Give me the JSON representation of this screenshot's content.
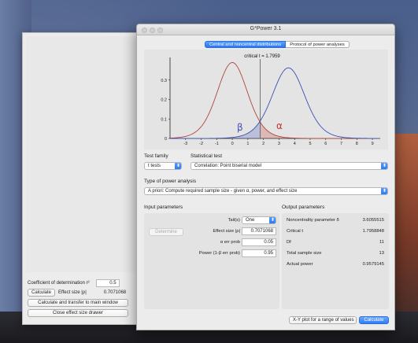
{
  "window": {
    "title": "G*Power 3.1"
  },
  "tabs": [
    {
      "label": "Central and noncentral distributions",
      "active": true
    },
    {
      "label": "Protocol of power analyses",
      "active": false
    }
  ],
  "plot": {
    "critical_label": "critical t = 1.7959",
    "beta_symbol": "β",
    "alpha_symbol": "α",
    "y_ticks": [
      "0.3",
      "0.2",
      "0.1",
      "0"
    ],
    "x_ticks": [
      "-3",
      "-2",
      "-1",
      "0",
      "1",
      "2",
      "3",
      "4",
      "5",
      "6",
      "7",
      "8",
      "9"
    ],
    "critical_t": 1.7959,
    "noncentrality": 3.6055515,
    "df": 11,
    "colors": {
      "null_curve": "#b0443a",
      "alt_curve": "#3a4fb8",
      "alpha": "#c0392b",
      "beta": "#4050b0"
    }
  },
  "test_family": {
    "label": "Test family",
    "value": "t tests"
  },
  "statistical_test": {
    "label": "Statistical test",
    "value": "Correlation: Point biserial model"
  },
  "power_analysis": {
    "label": "Type of power analysis",
    "value": "A priori: Compute required sample size - given α, power, and effect size"
  },
  "input": {
    "heading": "Input parameters",
    "determine": "Determine",
    "tails_label": "Tail(s)",
    "tails_value": "One",
    "effect_label": "Effect size |ρ|",
    "effect_value": "0.7071068",
    "alpha_label": "α err prob",
    "alpha_value": "0.05",
    "power_label": "Power (1-β err prob)",
    "power_value": "0.95"
  },
  "output": {
    "heading": "Output parameters",
    "rows": [
      {
        "label": "Noncentrality parameter δ",
        "value": "3.6055515"
      },
      {
        "label": "Critical t",
        "value": "1.7958848"
      },
      {
        "label": "Df",
        "value": "11"
      },
      {
        "label": "Total sample size",
        "value": "13"
      },
      {
        "label": "Actual power",
        "value": "0.9579145"
      }
    ]
  },
  "buttons": {
    "xy_plot": "X-Y plot for a range of values",
    "calculate": "Calculate"
  },
  "drawer": {
    "coef_label": "Coefficient of determination r²",
    "coef_value": "0.5",
    "calculate": "Calculate",
    "effect_label": "Effect size |ρ|",
    "effect_value": "0.7071068",
    "transfer": "Calculate and transfer to main window",
    "close": "Close effect size drawer"
  }
}
